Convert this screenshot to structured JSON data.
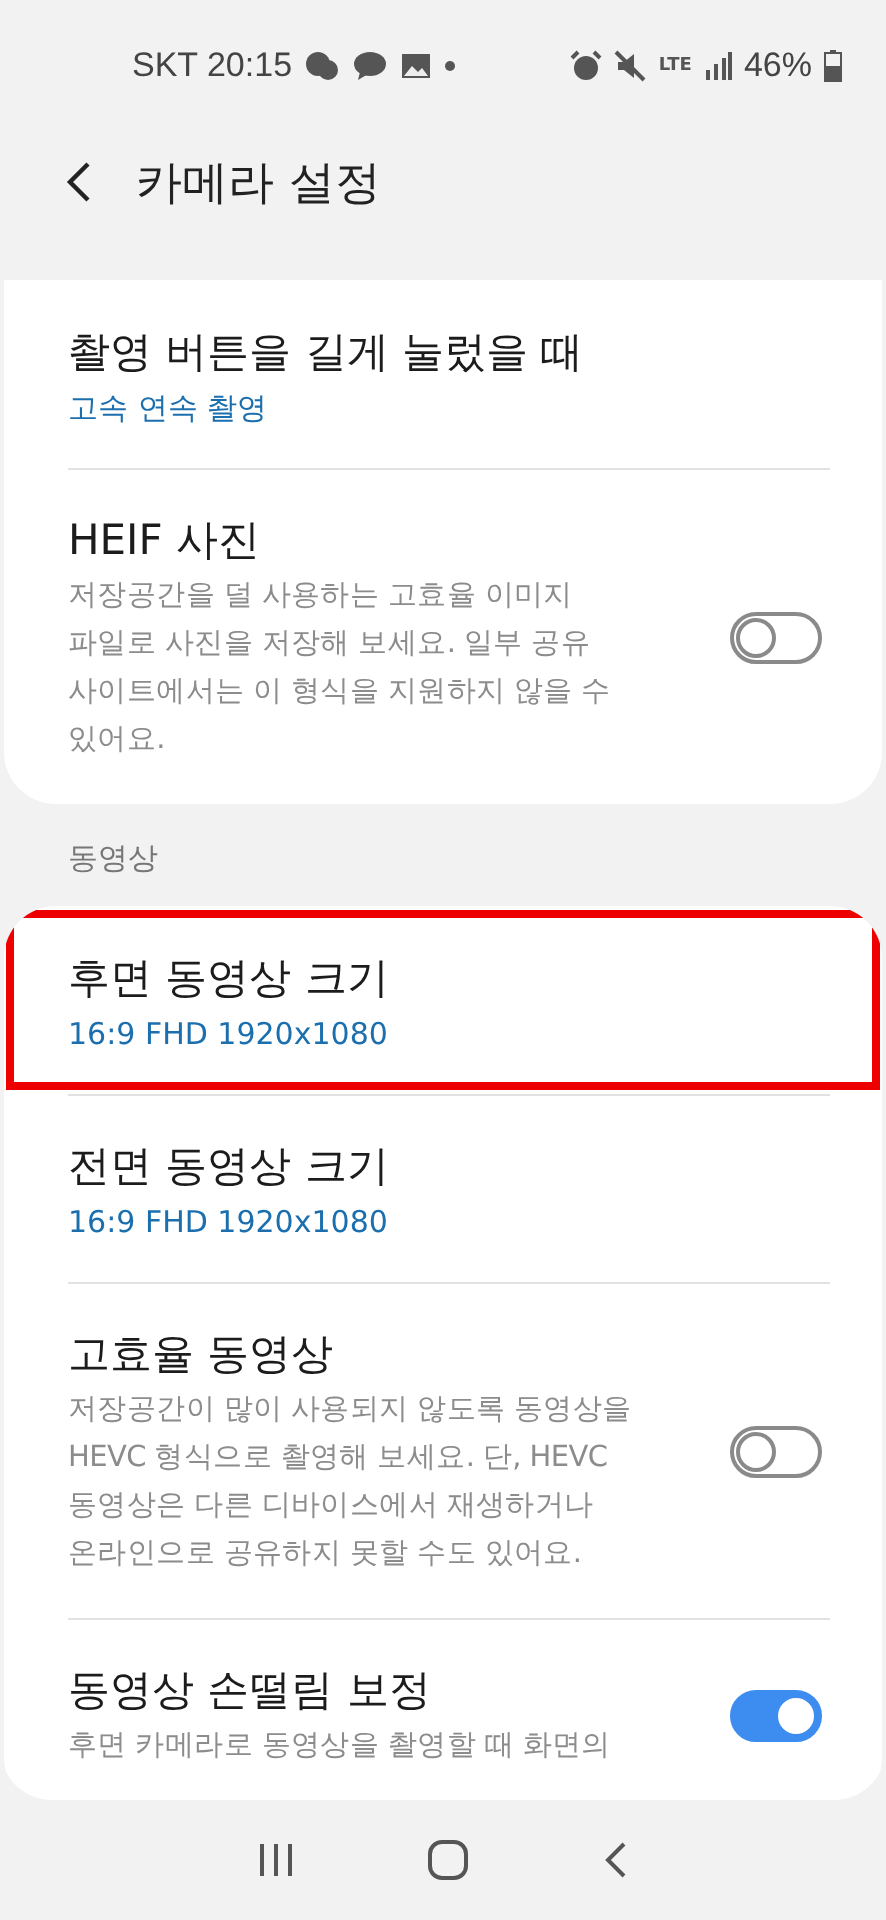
{
  "status_bar": {
    "carrier": "SKT",
    "time": "20:15",
    "network": "LTE",
    "battery": "46%"
  },
  "header": {
    "title": "카메라 설정"
  },
  "sections": [
    {
      "items": [
        {
          "kind": "value",
          "title": "촬영 버튼을 길게 눌렀을 때",
          "value": "고속 연속 촬영",
          "highlighted": false
        },
        {
          "kind": "toggle",
          "title": "HEIF 사진",
          "description": "저장공간을 덜 사용하는 고효율 이미지 파일로 사진을 저장해 보세요. 일부 공유 사이트에서는 이 형식을 지원하지 않을 수 있어요.",
          "on": false,
          "highlighted": false
        }
      ]
    },
    {
      "label": "동영상",
      "items": [
        {
          "kind": "value",
          "title": "후면 동영상 크기",
          "value": "16:9 FHD 1920x1080",
          "highlighted": true
        },
        {
          "kind": "value",
          "title": "전면 동영상 크기",
          "value": "16:9 FHD 1920x1080",
          "highlighted": false
        },
        {
          "kind": "toggle",
          "title": "고효율 동영상",
          "description": "저장공간이 많이 사용되지 않도록 동영상을 HEVC 형식으로 촬영해 보세요. 단, HEVC 동영상은 다른 디바이스에서 재생하거나 온라인으로 공유하지 못할 수도 있어요.",
          "on": false,
          "highlighted": false
        },
        {
          "kind": "toggle",
          "title": "동영상 손떨림 보정",
          "description": "후면 카메라로 동영상을 촬영할 때 화면의",
          "on": true,
          "highlighted": false
        }
      ]
    }
  ]
}
